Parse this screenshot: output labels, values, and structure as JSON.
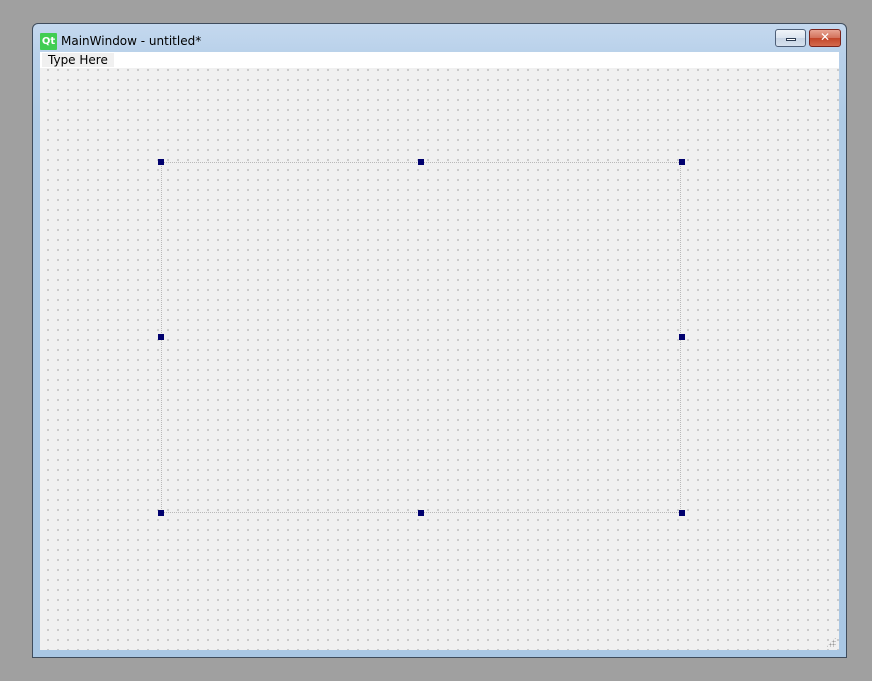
{
  "window": {
    "title": "MainWindow - untitled*",
    "app_icon_text": "Qt",
    "minimize_glyph": "minimize-icon",
    "close_glyph": "✕"
  },
  "menubar": {
    "placeholder_item": "Type Here"
  },
  "form": {
    "grid": "dotted",
    "selected_widget_handles": 8
  },
  "colors": {
    "desktop": "#a0a0a0",
    "form_background": "#f0f0f0",
    "selection_handle": "#00006e",
    "qt_icon": "#41cd52"
  }
}
